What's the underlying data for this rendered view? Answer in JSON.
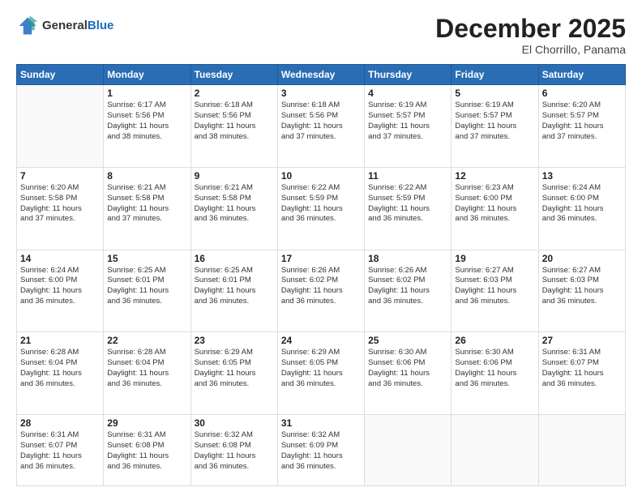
{
  "logo": {
    "general": "General",
    "blue": "Blue"
  },
  "header": {
    "month": "December 2025",
    "location": "El Chorrillo, Panama"
  },
  "weekdays": [
    "Sunday",
    "Monday",
    "Tuesday",
    "Wednesday",
    "Thursday",
    "Friday",
    "Saturday"
  ],
  "weeks": [
    [
      {
        "day": "",
        "sunrise": "",
        "sunset": "",
        "daylight": ""
      },
      {
        "day": "1",
        "sunrise": "Sunrise: 6:17 AM",
        "sunset": "Sunset: 5:56 PM",
        "daylight": "Daylight: 11 hours and 38 minutes."
      },
      {
        "day": "2",
        "sunrise": "Sunrise: 6:18 AM",
        "sunset": "Sunset: 5:56 PM",
        "daylight": "Daylight: 11 hours and 38 minutes."
      },
      {
        "day": "3",
        "sunrise": "Sunrise: 6:18 AM",
        "sunset": "Sunset: 5:56 PM",
        "daylight": "Daylight: 11 hours and 37 minutes."
      },
      {
        "day": "4",
        "sunrise": "Sunrise: 6:19 AM",
        "sunset": "Sunset: 5:57 PM",
        "daylight": "Daylight: 11 hours and 37 minutes."
      },
      {
        "day": "5",
        "sunrise": "Sunrise: 6:19 AM",
        "sunset": "Sunset: 5:57 PM",
        "daylight": "Daylight: 11 hours and 37 minutes."
      },
      {
        "day": "6",
        "sunrise": "Sunrise: 6:20 AM",
        "sunset": "Sunset: 5:57 PM",
        "daylight": "Daylight: 11 hours and 37 minutes."
      }
    ],
    [
      {
        "day": "7",
        "sunrise": "Sunrise: 6:20 AM",
        "sunset": "Sunset: 5:58 PM",
        "daylight": "Daylight: 11 hours and 37 minutes."
      },
      {
        "day": "8",
        "sunrise": "Sunrise: 6:21 AM",
        "sunset": "Sunset: 5:58 PM",
        "daylight": "Daylight: 11 hours and 37 minutes."
      },
      {
        "day": "9",
        "sunrise": "Sunrise: 6:21 AM",
        "sunset": "Sunset: 5:58 PM",
        "daylight": "Daylight: 11 hours and 36 minutes."
      },
      {
        "day": "10",
        "sunrise": "Sunrise: 6:22 AM",
        "sunset": "Sunset: 5:59 PM",
        "daylight": "Daylight: 11 hours and 36 minutes."
      },
      {
        "day": "11",
        "sunrise": "Sunrise: 6:22 AM",
        "sunset": "Sunset: 5:59 PM",
        "daylight": "Daylight: 11 hours and 36 minutes."
      },
      {
        "day": "12",
        "sunrise": "Sunrise: 6:23 AM",
        "sunset": "Sunset: 6:00 PM",
        "daylight": "Daylight: 11 hours and 36 minutes."
      },
      {
        "day": "13",
        "sunrise": "Sunrise: 6:24 AM",
        "sunset": "Sunset: 6:00 PM",
        "daylight": "Daylight: 11 hours and 36 minutes."
      }
    ],
    [
      {
        "day": "14",
        "sunrise": "Sunrise: 6:24 AM",
        "sunset": "Sunset: 6:00 PM",
        "daylight": "Daylight: 11 hours and 36 minutes."
      },
      {
        "day": "15",
        "sunrise": "Sunrise: 6:25 AM",
        "sunset": "Sunset: 6:01 PM",
        "daylight": "Daylight: 11 hours and 36 minutes."
      },
      {
        "day": "16",
        "sunrise": "Sunrise: 6:25 AM",
        "sunset": "Sunset: 6:01 PM",
        "daylight": "Daylight: 11 hours and 36 minutes."
      },
      {
        "day": "17",
        "sunrise": "Sunrise: 6:26 AM",
        "sunset": "Sunset: 6:02 PM",
        "daylight": "Daylight: 11 hours and 36 minutes."
      },
      {
        "day": "18",
        "sunrise": "Sunrise: 6:26 AM",
        "sunset": "Sunset: 6:02 PM",
        "daylight": "Daylight: 11 hours and 36 minutes."
      },
      {
        "day": "19",
        "sunrise": "Sunrise: 6:27 AM",
        "sunset": "Sunset: 6:03 PM",
        "daylight": "Daylight: 11 hours and 36 minutes."
      },
      {
        "day": "20",
        "sunrise": "Sunrise: 6:27 AM",
        "sunset": "Sunset: 6:03 PM",
        "daylight": "Daylight: 11 hours and 36 minutes."
      }
    ],
    [
      {
        "day": "21",
        "sunrise": "Sunrise: 6:28 AM",
        "sunset": "Sunset: 6:04 PM",
        "daylight": "Daylight: 11 hours and 36 minutes."
      },
      {
        "day": "22",
        "sunrise": "Sunrise: 6:28 AM",
        "sunset": "Sunset: 6:04 PM",
        "daylight": "Daylight: 11 hours and 36 minutes."
      },
      {
        "day": "23",
        "sunrise": "Sunrise: 6:29 AM",
        "sunset": "Sunset: 6:05 PM",
        "daylight": "Daylight: 11 hours and 36 minutes."
      },
      {
        "day": "24",
        "sunrise": "Sunrise: 6:29 AM",
        "sunset": "Sunset: 6:05 PM",
        "daylight": "Daylight: 11 hours and 36 minutes."
      },
      {
        "day": "25",
        "sunrise": "Sunrise: 6:30 AM",
        "sunset": "Sunset: 6:06 PM",
        "daylight": "Daylight: 11 hours and 36 minutes."
      },
      {
        "day": "26",
        "sunrise": "Sunrise: 6:30 AM",
        "sunset": "Sunset: 6:06 PM",
        "daylight": "Daylight: 11 hours and 36 minutes."
      },
      {
        "day": "27",
        "sunrise": "Sunrise: 6:31 AM",
        "sunset": "Sunset: 6:07 PM",
        "daylight": "Daylight: 11 hours and 36 minutes."
      }
    ],
    [
      {
        "day": "28",
        "sunrise": "Sunrise: 6:31 AM",
        "sunset": "Sunset: 6:07 PM",
        "daylight": "Daylight: 11 hours and 36 minutes."
      },
      {
        "day": "29",
        "sunrise": "Sunrise: 6:31 AM",
        "sunset": "Sunset: 6:08 PM",
        "daylight": "Daylight: 11 hours and 36 minutes."
      },
      {
        "day": "30",
        "sunrise": "Sunrise: 6:32 AM",
        "sunset": "Sunset: 6:08 PM",
        "daylight": "Daylight: 11 hours and 36 minutes."
      },
      {
        "day": "31",
        "sunrise": "Sunrise: 6:32 AM",
        "sunset": "Sunset: 6:09 PM",
        "daylight": "Daylight: 11 hours and 36 minutes."
      },
      {
        "day": "",
        "sunrise": "",
        "sunset": "",
        "daylight": ""
      },
      {
        "day": "",
        "sunrise": "",
        "sunset": "",
        "daylight": ""
      },
      {
        "day": "",
        "sunrise": "",
        "sunset": "",
        "daylight": ""
      }
    ]
  ]
}
